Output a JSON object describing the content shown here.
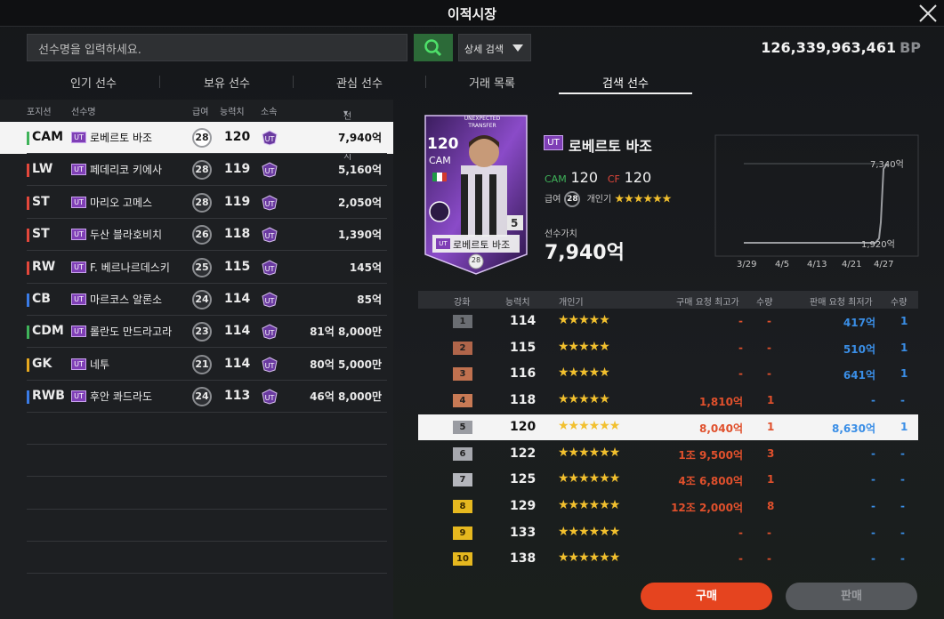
{
  "window": {
    "title": "이적시장"
  },
  "search": {
    "placeholder": "선수명을 입력하세요.",
    "detail_label": "상세 검색"
  },
  "balance": {
    "amount": "126,339,963,461",
    "unit": "BP"
  },
  "tabs": [
    "인기 선수",
    "보유 선수",
    "관심 선수",
    "거래 목록",
    "검색 선수"
  ],
  "list_headers": {
    "position": "포지션",
    "name": "선수명",
    "salary": "급여",
    "ovr": "능력치",
    "club": "소속",
    "value": "선수가치"
  },
  "players": [
    {
      "pos": "CAM",
      "color": "#3fb35a",
      "season": "UT",
      "name": "로베르토 바조",
      "salary": "28",
      "ovr": "120",
      "value": "7,940억"
    },
    {
      "pos": "LW",
      "color": "#e3473b",
      "season": "UT",
      "name": "페데리코 키에사",
      "salary": "28",
      "ovr": "119",
      "value": "5,160억"
    },
    {
      "pos": "ST",
      "color": "#e3473b",
      "season": "UT",
      "name": "마리오 고메스",
      "salary": "28",
      "ovr": "119",
      "value": "2,050억"
    },
    {
      "pos": "ST",
      "color": "#e3473b",
      "season": "UT",
      "name": "두산 블라호비치",
      "salary": "26",
      "ovr": "118",
      "value": "1,390억"
    },
    {
      "pos": "RW",
      "color": "#e3473b",
      "season": "UT",
      "name": "F. 베르나르데스키",
      "salary": "25",
      "ovr": "115",
      "value": "145억"
    },
    {
      "pos": "CB",
      "color": "#3a7be6",
      "season": "UT",
      "name": "마르코스 알론소",
      "salary": "24",
      "ovr": "114",
      "value": "85억"
    },
    {
      "pos": "CDM",
      "color": "#3fb35a",
      "season": "UT",
      "name": "롤란도 만드라고라",
      "salary": "23",
      "ovr": "114",
      "value": "81억 8,000만"
    },
    {
      "pos": "GK",
      "color": "#e6a81f",
      "season": "UT",
      "name": "네투",
      "salary": "21",
      "ovr": "114",
      "value": "80억 5,000만"
    },
    {
      "pos": "RWB",
      "color": "#3a7be6",
      "season": "UT",
      "name": "후안 콰드라도",
      "salary": "24",
      "ovr": "113",
      "value": "46억 8,000만"
    }
  ],
  "detail": {
    "card": {
      "ovr": "120",
      "pos": "CAM",
      "promo": "UNEXPECTED TRANSFER",
      "level": "5",
      "name": "로베르토 바조",
      "salary": "28",
      "season": "UT"
    },
    "season": "UT",
    "name": "로베르토 바조",
    "pos1": "CAM",
    "ovr1": "120",
    "pos2": "CF",
    "ovr2": "120",
    "salary_label": "급여",
    "salary": "28",
    "skill_label": "개인기",
    "skill_stars": "★★★★★★",
    "value_label": "선수가치",
    "value": "7,940억"
  },
  "price_graph": {
    "dates": [
      "3/29",
      "4/5",
      "4/13",
      "4/21",
      "4/27"
    ],
    "high_label": "7,340억",
    "low_label": "1,920억"
  },
  "grade_headers": {
    "grade": "강화",
    "ovr": "능력치",
    "skill": "개인기",
    "buy_max": "구매 요청 최고가",
    "buy_qty": "수량",
    "sell_min": "판매 요청 최저가",
    "sell_qty": "수량"
  },
  "grades": [
    {
      "lvl": "1",
      "color": "#6a6d72",
      "ovr": "114",
      "stars": "★★★★★",
      "buy": "-",
      "bq": "-",
      "sell": "417억",
      "sq": "1"
    },
    {
      "lvl": "2",
      "color": "#b0654a",
      "ovr": "115",
      "stars": "★★★★★",
      "buy": "-",
      "bq": "-",
      "sell": "510억",
      "sq": "1"
    },
    {
      "lvl": "3",
      "color": "#c0714f",
      "ovr": "116",
      "stars": "★★★★★",
      "buy": "-",
      "bq": "-",
      "sell": "641억",
      "sq": "1"
    },
    {
      "lvl": "4",
      "color": "#c87a55",
      "ovr": "118",
      "stars": "★★★★★",
      "buy": "1,810억",
      "bq": "1",
      "sell": "-",
      "sq": "-"
    },
    {
      "lvl": "5",
      "color": "#9a9ca2",
      "ovr": "120",
      "stars": "★★★★★★",
      "buy": "8,040억",
      "bq": "1",
      "sell": "8,630억",
      "sq": "1"
    },
    {
      "lvl": "6",
      "color": "#a6a8ae",
      "ovr": "122",
      "stars": "★★★★★★",
      "buy": "1조 9,500억",
      "bq": "3",
      "sell": "-",
      "sq": "-"
    },
    {
      "lvl": "7",
      "color": "#b4b6bc",
      "ovr": "125",
      "stars": "★★★★★★",
      "buy": "4조 6,800억",
      "bq": "1",
      "sell": "-",
      "sq": "-"
    },
    {
      "lvl": "8",
      "color": "#e6b81f",
      "ovr": "129",
      "stars": "★★★★★★",
      "buy": "12조 2,000억",
      "bq": "8",
      "sell": "-",
      "sq": "-"
    },
    {
      "lvl": "9",
      "color": "#e6b81f",
      "ovr": "133",
      "stars": "★★★★★★",
      "buy": "-",
      "bq": "-",
      "sell": "-",
      "sq": "-"
    },
    {
      "lvl": "10",
      "color": "#e6b81f",
      "ovr": "138",
      "stars": "★★★★★★",
      "buy": "-",
      "bq": "-",
      "sell": "-",
      "sq": "-"
    }
  ],
  "actions": {
    "buy": "구매",
    "sell": "판매"
  }
}
